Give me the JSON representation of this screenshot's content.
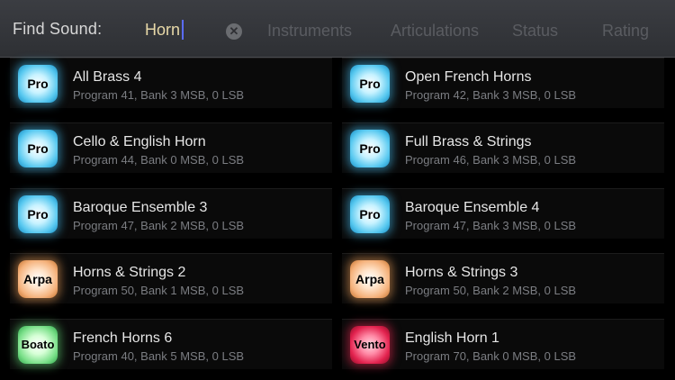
{
  "header": {
    "find_label": "Find Sound:",
    "search_value": "Horn",
    "clear_icon": "close-circle-icon",
    "tabs": [
      "Instruments",
      "Articulations",
      "Status",
      "Rating"
    ]
  },
  "badge_colors": {
    "Pro": "#59c9f0",
    "Arpa": "#f5b27c",
    "Boato": "#7be08a",
    "Vento": "#e3234f"
  },
  "sounds": [
    {
      "badge": "Pro",
      "name": "All Brass 4",
      "detail": "Program 41, Bank 3 MSB, 0 LSB"
    },
    {
      "badge": "Pro",
      "name": "Open French Horns",
      "detail": "Program 42, Bank 3 MSB, 0 LSB"
    },
    {
      "badge": "Pro",
      "name": "Cello & English Horn",
      "detail": "Program 44, Bank 0 MSB, 0 LSB"
    },
    {
      "badge": "Pro",
      "name": "Full Brass & Strings",
      "detail": "Program 46, Bank 3 MSB, 0 LSB"
    },
    {
      "badge": "Pro",
      "name": "Baroque Ensemble 3",
      "detail": "Program 47, Bank 2 MSB, 0 LSB"
    },
    {
      "badge": "Pro",
      "name": "Baroque Ensemble 4",
      "detail": "Program 47, Bank 3 MSB, 0 LSB"
    },
    {
      "badge": "Arpa",
      "name": "Horns & Strings 2",
      "detail": "Program 50, Bank 1 MSB, 0 LSB"
    },
    {
      "badge": "Arpa",
      "name": "Horns & Strings 3",
      "detail": "Program 50, Bank 2 MSB, 0 LSB"
    },
    {
      "badge": "Boato",
      "name": "French Horns 6",
      "detail": "Program 40, Bank 5 MSB, 0 LSB"
    },
    {
      "badge": "Vento",
      "name": "English Horn 1",
      "detail": "Program 70, Bank 0 MSB, 0 LSB"
    }
  ]
}
